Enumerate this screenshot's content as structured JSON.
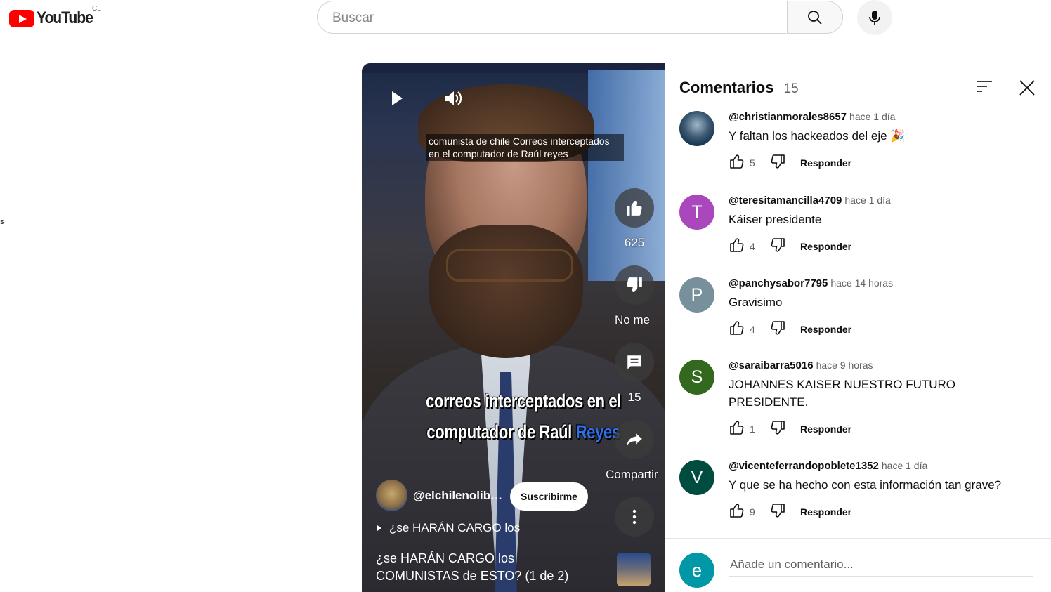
{
  "masthead": {
    "logo_text": "YouTube",
    "country_code": "CL",
    "search_placeholder": "Buscar"
  },
  "sidebar_fragment": "s",
  "video": {
    "overlay_title": "comunista de chile Correos interceptados en el computador de Raúl reyes",
    "caption_line1": "correos interceptados en el",
    "caption_line2_white": "computador de Raúl",
    "caption_line2_blue": "Reyes",
    "like_count": "625",
    "dislike_label": "No me",
    "comment_count": "15",
    "share_label": "Compartir",
    "channel_name": "@elchilenolibe...",
    "subscribe_label": "Suscribirme",
    "description_snippet": "¿se HARÁN CARGO los",
    "next_title": "¿se HARÁN CARGO los COMUNISTAS de ESTO? (1 de 2)"
  },
  "comments_panel": {
    "title": "Comentarios",
    "count": "15",
    "reply_label": "Responder",
    "add_placeholder": "Añade un comentario...",
    "current_user_initial": "e",
    "items": [
      {
        "author": "@christianmorales8657",
        "time": "hace 1 día",
        "text": "Y faltan los hackeados del eje 🎉",
        "likes": "5",
        "initial": "",
        "avatar_color": "#1d3b55"
      },
      {
        "author": "@teresitamancilla4709",
        "time": "hace 1 día",
        "text": "Káiser presidente",
        "likes": "4",
        "initial": "T",
        "avatar_color": "#ab47bc"
      },
      {
        "author": "@panchysabor7795",
        "time": "hace 14 horas",
        "text": "Gravisimo",
        "likes": "4",
        "initial": "P",
        "avatar_color": "#78909c"
      },
      {
        "author": "@saraibarra5016",
        "time": "hace 9 horas",
        "text": "JOHANNES KAISER NUESTRO FUTURO PRESIDENTE.",
        "likes": "1",
        "initial": "S",
        "avatar_color": "#33691e"
      },
      {
        "author": "@vicenteferrandopoblete1352",
        "time": "hace 1 día",
        "text": "Y que se ha hecho con esta información tan grave?",
        "likes": "9",
        "initial": "V",
        "avatar_color": "#004d40"
      }
    ]
  }
}
